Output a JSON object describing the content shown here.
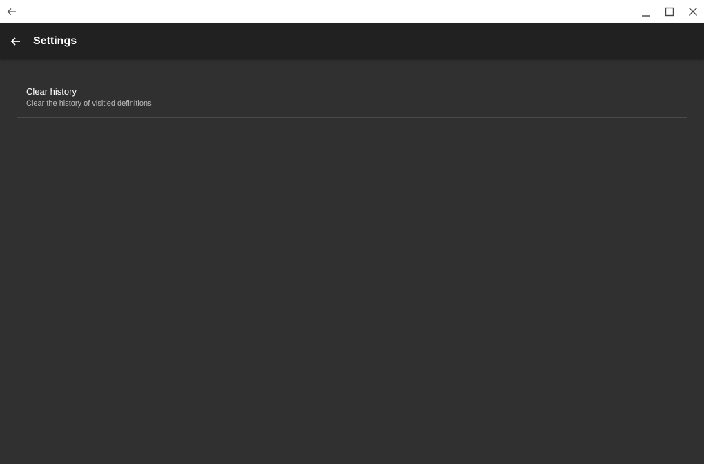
{
  "window": {
    "back_icon": "arrow-left-icon",
    "minimize_icon": "minimize-icon",
    "maximize_icon": "maximize-icon",
    "close_icon": "close-icon"
  },
  "app_bar": {
    "back_icon": "arrow-left-icon",
    "title": "Settings",
    "background": "#212121"
  },
  "preferences": [
    {
      "title": "Clear history",
      "summary": "Clear the history of visitied definitions"
    }
  ],
  "colors": {
    "background": "#303030",
    "divider": "#4a4a4a"
  }
}
